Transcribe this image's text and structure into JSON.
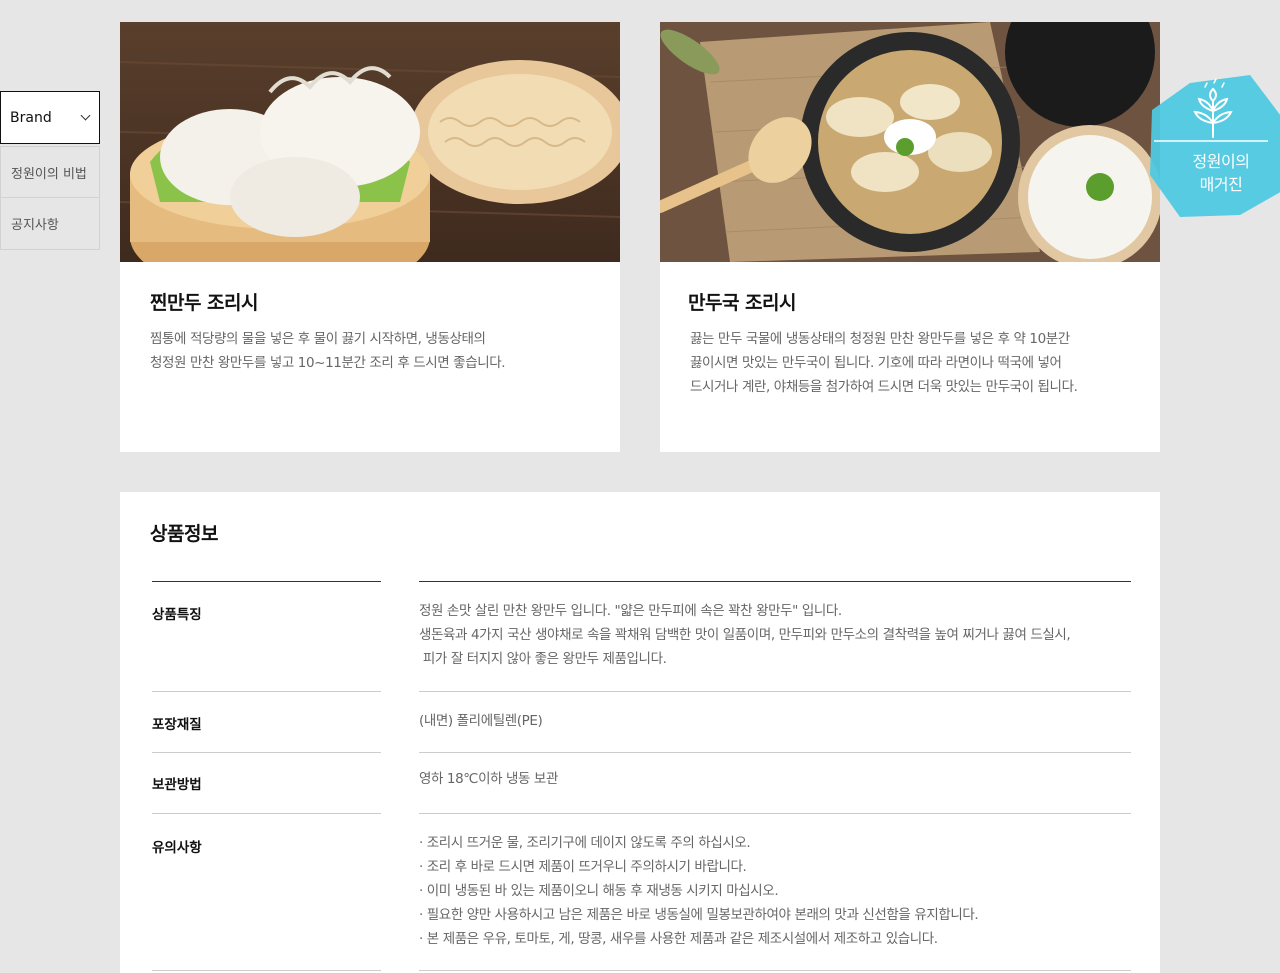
{
  "side_nav": {
    "select_label": "Brand",
    "items": [
      {
        "label": "정원이의 비법"
      },
      {
        "label": "공지사항"
      }
    ]
  },
  "cards": [
    {
      "title": "찐만두 조리시",
      "lines": [
        "찜통에 적당량의 물을 넣은 후 물이 끓기 시작하면, 냉동상태의",
        "청정원 만찬 왕만두를 넣고 10~11분간 조리 후 드시면 좋습니다."
      ]
    },
    {
      "title": "만두국 조리시",
      "lines": [
        "끓는 만두 국물에 냉동상태의 청정원 만찬 왕만두를 넣은 후 약 10분간",
        "끓이시면 맛있는 만두국이 됩니다. 기호에 따라 라면이나 떡국에 넣어",
        "드시거나 계란, 야채등을 첨가하여 드시면 더욱 맛있는 만두국이 됩니다."
      ]
    }
  ],
  "magazine": {
    "line1": "정원이의",
    "line2": "매거진",
    "color": "#4ec9e1"
  },
  "product_info": {
    "title": "상품정보",
    "rows": [
      {
        "label": "상품특징",
        "lines": [
          "정원 손맛 살린 만찬 왕만두 입니다. \"얇은 만두피에 속은 꽉찬 왕만두\" 입니다.",
          "생돈육과 4가지 국산 생야채로 속을 꽉채워 담백한 맛이 일품이며, 만두피와 만두소의 결착력을 높여 찌거나 끓여 드실시,",
          " 피가 잘 터지지 않아 좋은 왕만두 제품입니다."
        ]
      },
      {
        "label": "포장재질",
        "lines": [
          "(내면) 폴리에틸렌(PE)"
        ]
      },
      {
        "label": "보관방법",
        "lines": [
          "영하 18℃이하 냉동 보관"
        ]
      },
      {
        "label": "유의사항",
        "lines": [
          "· 조리시 뜨거운 물, 조리기구에 데이지 않도록 주의 하십시오.",
          "· 조리 후 바로 드시면 제품이 뜨거우니 주의하시기 바랍니다.",
          "· 이미 냉동된 바 있는 제품이오니 해동 후 재냉동 시키지 마십시오.",
          "· 필요한 양만 사용하시고 남은 제품은 바로 냉동실에 밀봉보관하여야 본래의 맛과 신선함을 유지합니다.",
          "· 본 제품은 우유, 토마토, 게, 땅콩, 새우를 사용한 제품과 같은 제조시설에서 제조하고 있습니다."
        ]
      }
    ]
  }
}
